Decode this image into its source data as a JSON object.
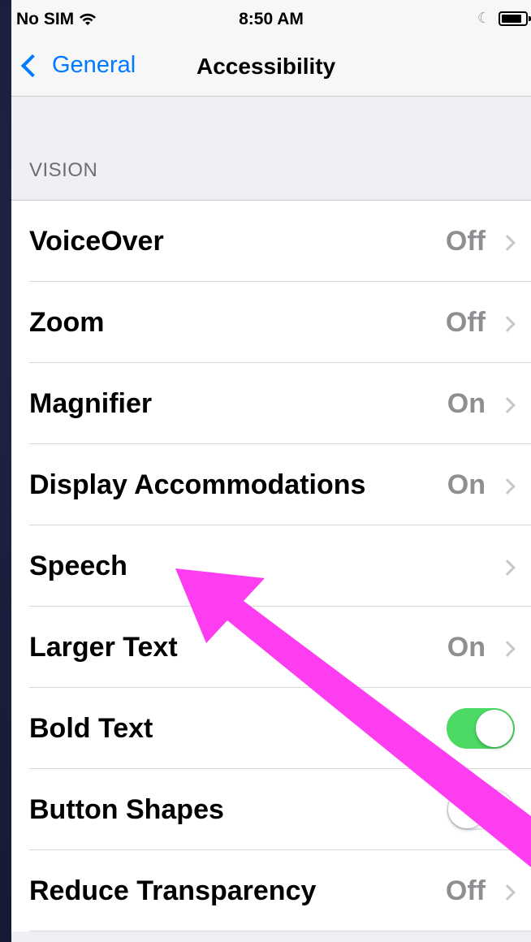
{
  "status_bar": {
    "carrier": "No SIM",
    "time": "8:50 AM",
    "icons": [
      "wifi-icon",
      "moon-icon",
      "battery-icon"
    ]
  },
  "nav": {
    "back_label": "General",
    "title": "Accessibility"
  },
  "section": {
    "header": "VISION"
  },
  "rows": [
    {
      "label": "VoiceOver",
      "value": "Off",
      "type": "disclosure"
    },
    {
      "label": "Zoom",
      "value": "Off",
      "type": "disclosure"
    },
    {
      "label": "Magnifier",
      "value": "On",
      "type": "disclosure"
    },
    {
      "label": "Display Accommodations",
      "value": "On",
      "type": "disclosure"
    },
    {
      "label": "Speech",
      "value": "",
      "type": "disclosure"
    },
    {
      "label": "Larger Text",
      "value": "On",
      "type": "disclosure"
    },
    {
      "label": "Bold Text",
      "toggle": true,
      "type": "toggle"
    },
    {
      "label": "Button Shapes",
      "toggle": false,
      "type": "toggle"
    },
    {
      "label": "Reduce Transparency",
      "value": "Off",
      "type": "disclosure"
    }
  ],
  "colors": {
    "accent": "#007aff",
    "toggle_on": "#4cd964",
    "annotation_arrow": "#ff3df0"
  }
}
